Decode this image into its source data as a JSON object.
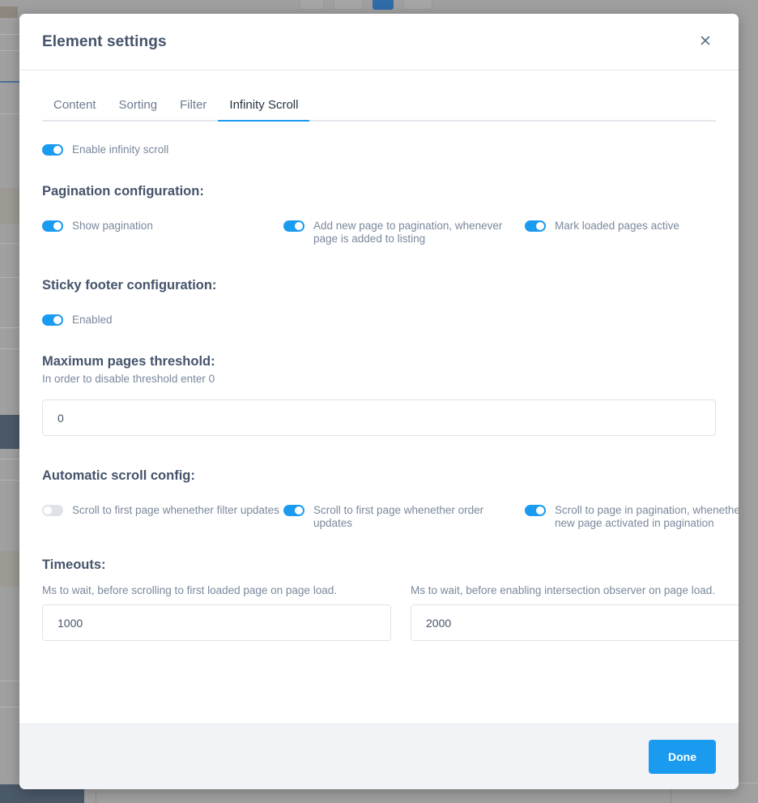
{
  "modal": {
    "title": "Element settings",
    "close_icon": "close-icon",
    "tabs": [
      {
        "label": "Content",
        "active": false
      },
      {
        "label": "Sorting",
        "active": false
      },
      {
        "label": "Filter",
        "active": false
      },
      {
        "label": "Infinity Scroll",
        "active": true
      }
    ],
    "enable_infinity_scroll": {
      "label": "Enable infinity scroll",
      "state": "on"
    },
    "pagination": {
      "heading": "Pagination configuration:",
      "toggles": [
        {
          "label": "Show pagination",
          "state": "on"
        },
        {
          "label": "Add new page to pagination, whenever page is added to listing",
          "state": "on"
        },
        {
          "label": "Mark loaded pages active",
          "state": "on"
        }
      ]
    },
    "sticky_footer": {
      "heading": "Sticky footer configuration:",
      "toggles": [
        {
          "label": "Enabled",
          "state": "on"
        }
      ]
    },
    "threshold": {
      "heading": "Maximum pages threshold:",
      "subtext": "In order to disable threshold enter 0",
      "value": "0",
      "placeholder": ""
    },
    "automatic_scroll": {
      "heading": "Automatic scroll config:",
      "toggles": [
        {
          "label": "Scroll to first page whenether filter updates",
          "state": "off"
        },
        {
          "label": "Scroll to first page whenether order updates",
          "state": "on"
        },
        {
          "label": "Scroll to page in pagination, whenether new page activated in pagination",
          "state": "on"
        }
      ]
    },
    "timeouts": {
      "heading": "Timeouts:",
      "fields": [
        {
          "label": "Ms to wait, before scrolling to first loaded page on page load.",
          "value": "1000",
          "placeholder": ""
        },
        {
          "label": "Ms to wait, before enabling intersection observer on page load.",
          "value": "2000",
          "placeholder": ""
        }
      ]
    },
    "footer": {
      "done_label": "Done"
    }
  },
  "colors": {
    "accent": "#1b9bf0",
    "heading": "#45536b",
    "muted": "#7a889c",
    "toggle_off": "#dfe3e8",
    "footer_bg": "#f1f3f6"
  }
}
